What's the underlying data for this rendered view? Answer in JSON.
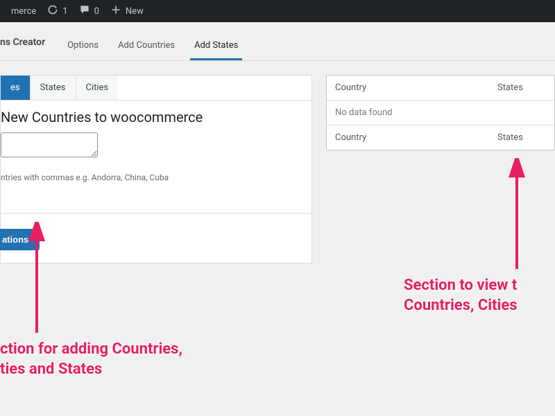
{
  "admin_bar": {
    "site_label": "merce",
    "updates_count": "1",
    "comments_count": "0",
    "new_label": "New"
  },
  "subnav": {
    "breadcrumb": "ns Creator",
    "tabs": [
      {
        "label": "Options",
        "active": false
      },
      {
        "label": "Add Countries",
        "active": false
      },
      {
        "label": "Add States",
        "active": true
      }
    ]
  },
  "panel": {
    "mini_tabs": [
      {
        "label": "es",
        "active": true
      },
      {
        "label": "States",
        "active": false
      },
      {
        "label": "Cities",
        "active": false
      }
    ],
    "heading": "New Countries to woocommerce",
    "textarea_value": "",
    "hint": "ntries with commas e.g. Andorra, China, Cuba",
    "button_label": "ations"
  },
  "table": {
    "header": {
      "col1": "Country",
      "col2": "States"
    },
    "empty": "No data found",
    "footer": {
      "col1": "Country",
      "col2": "States"
    }
  },
  "annotations": {
    "left": "ction for adding Countries,\nties and States",
    "right": "Section to view t\nCountries, Cities"
  },
  "colors": {
    "accent": "#2271b1",
    "annotation": "#e91e63"
  }
}
